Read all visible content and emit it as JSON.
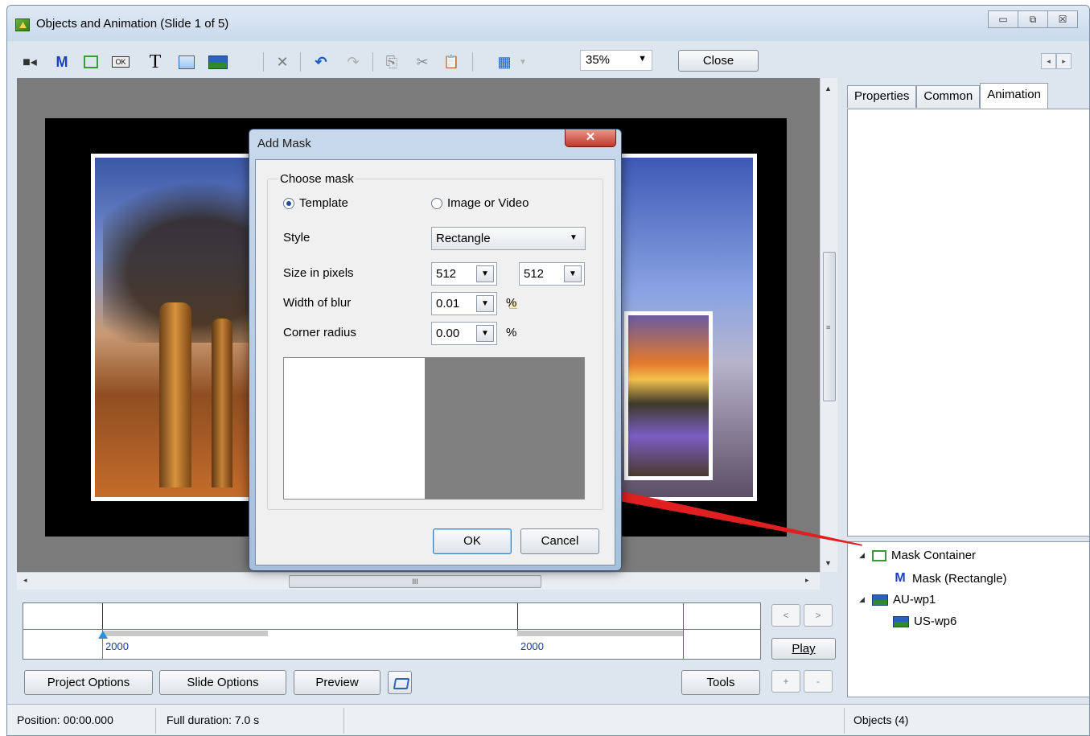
{
  "window": {
    "title": "Objects and Animation  (Slide 1 of 5)",
    "controls": [
      "▭",
      "⧉",
      "☒"
    ]
  },
  "toolbar": {
    "zoom_value": "35%",
    "close_label": "Close",
    "scroll_left": "◂",
    "scroll_right": "▸",
    "icons": [
      "camera-icon",
      "mask-icon",
      "frame-icon",
      "button-icon",
      "text-icon",
      "rectangle-icon",
      "image-icon",
      "delete-icon",
      "undo-icon",
      "redo-icon",
      "copy-icon",
      "cut-icon",
      "paste-icon",
      "grid-icon"
    ],
    "mask_glyph": "M",
    "text_glyph": "T",
    "ok_glyph": "OK",
    "delete_glyph": "✕",
    "undo_glyph": "↶",
    "redo_glyph": "↷",
    "copy_glyph": "⎘",
    "cut_glyph": "✂",
    "paste_glyph": "📋",
    "grid_glyph": "▦"
  },
  "scrollbars": {
    "grip_v": "≡",
    "grip_h": "III",
    "up": "▲",
    "down": "▼",
    "left": "◂",
    "right": "▸"
  },
  "timeline": {
    "labels": [
      "2000",
      "2000"
    ]
  },
  "transport": {
    "prev": "<",
    "next": ">",
    "play_label": "Play",
    "plus": "+",
    "minus": "-"
  },
  "bottom_buttons": {
    "project_options": "Project Options",
    "slide_options": "Slide Options",
    "preview": "Preview",
    "tools": "Tools"
  },
  "status": {
    "position": "Position: 00:00.000",
    "duration": "Full duration: 7.0 s",
    "objects": "Objects (4)"
  },
  "right_panel": {
    "tabs": [
      "Properties",
      "Common",
      "Animation"
    ],
    "active_tab": "Animation",
    "tree": [
      {
        "label": "Mask Container",
        "icon": "mask-container-icon",
        "expanded": true
      },
      {
        "label": "Mask (Rectangle)",
        "icon": "mask-icon"
      },
      {
        "label": "AU-wp1",
        "icon": "image-icon",
        "expanded": true
      },
      {
        "label": "US-wp6",
        "icon": "image-icon"
      }
    ],
    "expander": "◢"
  },
  "dialog": {
    "title": "Add Mask",
    "close_glyph": "✕",
    "group_label": "Choose mask",
    "radio_template": "Template",
    "radio_image": "Image or Video",
    "selected": "Template",
    "style_label": "Style",
    "style_value": "Rectangle",
    "size_label": "Size in pixels",
    "size_width": "512",
    "size_height": "512",
    "blur_label": "Width of blur",
    "blur_value": "0.01",
    "corner_label": "Corner radius",
    "corner_value": "0.00",
    "percent": "%",
    "dropdown_glyph": "▼",
    "ok_label": "OK",
    "cancel_label": "Cancel"
  },
  "colors": {
    "accent": "#2b8fe0",
    "timeline_label": "#1a3d8f",
    "arrow": "#e02020",
    "mask_container": "#3a9a3a",
    "mask_icon": "#1b3fc4"
  }
}
